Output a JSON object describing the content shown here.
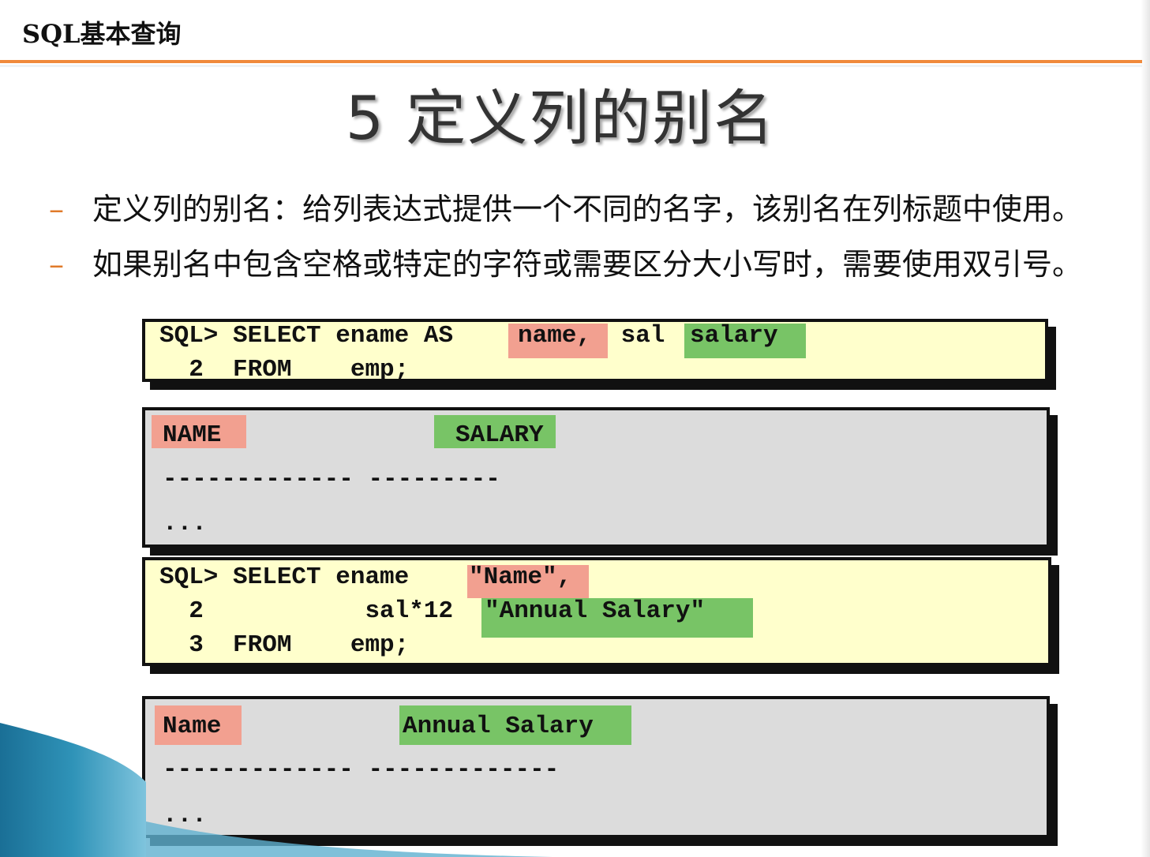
{
  "header": {
    "title": "SQL基本查询"
  },
  "slide_title": "5  定义列的别名",
  "bullets": [
    {
      "dash": "–",
      "text": "定义列的别名：给列表达式提供一个不同的名字，该别名在列标题中使用。"
    },
    {
      "dash": "–",
      "text": "如果别名中包含空格或特定的字符或需要区分大小写时，需要使用双引号。"
    }
  ],
  "query1": {
    "l1_prefix": "SQL> SELECT ename AS ",
    "l1_alias1": "name,",
    "l1_mid": " sal ",
    "l1_alias2": "salary",
    "l2": "  2  FROM    emp;"
  },
  "result1": {
    "col1": "NAME",
    "col2": "SALARY",
    "divider": "------------- ---------",
    "ellipsis": "..."
  },
  "query2": {
    "l1_prefix": "SQL> SELECT ename ",
    "l1_alias": "\"Name\",",
    "l2_prefix": "  2           sal*12 ",
    "l2_alias": "\"Annual Salary\"",
    "l3": "  3  FROM    emp;"
  },
  "result2": {
    "col1": "Name",
    "col2": "Annual Salary",
    "divider": "------------- -------------",
    "ellipsis": "..."
  },
  "colors": {
    "accent": "#f08a3c",
    "alias_red": "#f2a090",
    "alias_green": "#78c466",
    "sql_bg": "#ffffcc",
    "result_bg": "#dcdcdc"
  }
}
